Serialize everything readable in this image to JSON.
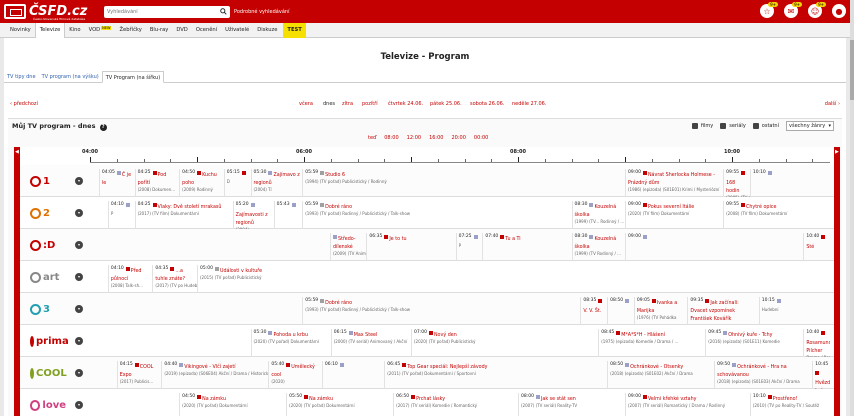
{
  "header": {
    "logo_text": "ČSFD.cz",
    "logo_sub": "Česko-Slovenská filmová databáze",
    "search_placeholder": "Vyhledávání",
    "advanced_search": "Podrobné vyhledávání",
    "icons": [
      {
        "name": "bell-icon",
        "glyph": "☆",
        "badge": "9+"
      },
      {
        "name": "messages-icon",
        "glyph": "✉",
        "badge": "9+"
      },
      {
        "name": "friends-icon",
        "glyph": "☺",
        "badge": "9+"
      },
      {
        "name": "user-avatar-icon",
        "glyph": "●",
        "badge": ""
      }
    ],
    "accent_color": "#c40000"
  },
  "menu": {
    "items": [
      "Novinky",
      "Televize",
      "Kino",
      "VOD",
      "Žebříčky",
      "Blu-ray",
      "DVD",
      "Ocenění",
      "Uživatelé",
      "Diskuze"
    ],
    "active": "Televize",
    "vod_badge": "NEW",
    "test_label": "TEST"
  },
  "page": {
    "title": "Televize - Program",
    "subtabs": [
      "TV tipy dne",
      "TV program (na výšku)",
      "TV Program (na šířku)"
    ],
    "active_subtab": "TV Program (na šířku)",
    "prev_label": "‹ předchozí",
    "next_label": "další ›",
    "days": [
      "včera",
      "dnes",
      "zítra",
      "pozítří",
      "čtvrtek 24.06.",
      "pátek 25.06.",
      "sobota 26.06.",
      "neděle 27.06."
    ],
    "current_day": "dnes"
  },
  "section": {
    "title": "Můj TV program - dnes",
    "help": "?",
    "filters": [
      {
        "label": "filmy",
        "checked": true
      },
      {
        "label": "seriály",
        "checked": true
      },
      {
        "label": "ostatní",
        "checked": true
      }
    ],
    "genre_select": "všechny žánry",
    "time_links": [
      "teď",
      "08:00",
      "12:00",
      "16:00",
      "20:00",
      "00:00"
    ],
    "axis_labels": [
      "04:00",
      "06:00",
      "08:00",
      "10:00"
    ]
  },
  "channels": [
    {
      "name": "ČT1",
      "logo": "1",
      "color": "#c40000",
      "programs": [
        {
          "time": "04:05",
          "title": "Č je le",
          "meta": "",
          "cat": "serial"
        },
        {
          "time": "04:25",
          "title": "Pod pořítí",
          "meta": "(2008) Dokumen...",
          "cat": "film"
        },
        {
          "time": "04:50",
          "title": "Kuchu poho",
          "meta": "(2009) Rodinný",
          "cat": "film"
        },
        {
          "time": "05:15",
          "title": "",
          "meta": "D",
          "cat": "film"
        },
        {
          "time": "05:30",
          "title": "Zajímavo z regionů",
          "meta": "(2004) Tí",
          "cat": "serial"
        },
        {
          "time": "05:59",
          "title": "Studio 6",
          "meta": "(1994) (TV pořad) Publicistický / Rodinný",
          "cat": "ostatni"
        },
        {
          "time": "09:00",
          "title": "Návrat Sherlocka Holmese - Prázdný dům",
          "meta": "(1986) (epizoda) (S01E01) Krimi / Mysteriózní",
          "cat": "film"
        },
        {
          "time": "09:55",
          "title": "168 hodin",
          "meta": "(2005) (TV po Publicistický",
          "cat": "film"
        },
        {
          "time": "10:10",
          "title": "",
          "meta": "",
          "cat": "serial"
        }
      ]
    },
    {
      "name": "ČT2",
      "logo": "2",
      "color": "#e07000",
      "programs": [
        {
          "time": "04:10",
          "title": "",
          "meta": "P",
          "cat": "serial"
        },
        {
          "time": "04:25",
          "title": "Vlaky: Dvě století mrakasů",
          "meta": "(2017) (TV film) Dokumentární",
          "cat": "film"
        },
        {
          "time": "05:20",
          "title": "Zajímavosti z regionů",
          "meta": "(2004)",
          "cat": "serial"
        },
        {
          "time": "05:43",
          "title": "",
          "meta": "",
          "cat": "serial"
        },
        {
          "time": "05:59",
          "title": "Dobré ráno",
          "meta": "(1993) (TV pořad) Rodinný / Publicistický / Talk-show",
          "cat": "ostatni"
        },
        {
          "time": "08:30",
          "title": "Kouzelná školka",
          "meta": "(1999) (TV... Rodinný / ...",
          "cat": "serial"
        },
        {
          "time": "09:00",
          "title": "Pokus severní Itálie",
          "meta": "(2020) (TV film) Dokumentární",
          "cat": "film"
        },
        {
          "time": "09:55",
          "title": "Chytré opice",
          "meta": "(2008) (TV film) Dokumentární",
          "cat": "film"
        }
      ]
    },
    {
      "name": "ČT :D",
      "logo": ":D",
      "color": "#c40000",
      "programs": [
        {
          "time": "",
          "title": "Středo-dílenské",
          "meta": "(2009) (TV Animovaný",
          "cat": "serial"
        },
        {
          "time": "06:35",
          "title": "Je to tu",
          "meta": "",
          "cat": "film"
        },
        {
          "time": "07:25",
          "title": "",
          "meta": "P",
          "cat": "serial"
        },
        {
          "time": "07:40",
          "title": "Tu a Ti",
          "meta": "",
          "cat": "film"
        },
        {
          "time": "08:30",
          "title": "Kouzelná školka",
          "meta": "(1999) (TV Rodinný / ...",
          "cat": "serial"
        },
        {
          "time": "09:00",
          "title": "",
          "meta": "",
          "cat": "serial"
        },
        {
          "time": "10:40",
          "title": "Sté",
          "meta": "",
          "cat": "film"
        }
      ]
    },
    {
      "name": "ČT art",
      "logo": "art",
      "color": "#888888",
      "programs": [
        {
          "time": "04:10",
          "title": "Před půlnocí",
          "meta": "(2008) Talk-sh...",
          "cat": "film"
        },
        {
          "time": "04:35",
          "title": "...a tuhle znáte?",
          "meta": "(2017) (TV po Hudební",
          "cat": "film"
        },
        {
          "time": "05:00",
          "title": "Události v kultuře",
          "meta": "(2015) (TV pořad) Publicistický",
          "cat": "ostatni"
        }
      ]
    },
    {
      "name": "ČT3",
      "logo": "3",
      "color": "#20a0b0",
      "programs": [
        {
          "time": "05:59",
          "title": "Dobré ráno",
          "meta": "(1993) (TV pořad) Rodinný / Publicistický / Talk-show",
          "cat": "ostatni"
        },
        {
          "time": "08:35",
          "title": "V. V. Št.",
          "meta": "",
          "cat": "film"
        },
        {
          "time": "08:50",
          "title": "",
          "meta": "",
          "cat": "serial"
        },
        {
          "time": "09:05",
          "title": "Ivanka a Marijka",
          "meta": "(1976) (TV Pohádka",
          "cat": "film"
        },
        {
          "time": "09:35",
          "title": "Jak začínali: Dvacet vzpomínek František Kovářík",
          "meta": "",
          "cat": "film"
        },
        {
          "time": "10:15",
          "title": "",
          "meta": "Hudební",
          "cat": "serial"
        }
      ]
    },
    {
      "name": "Prima",
      "logo": "prima",
      "color": "#c40000",
      "programs": [
        {
          "time": "05:30",
          "title": "Pohoda u krbu",
          "meta": "(2020) (TV pořad) Dokumentární",
          "cat": "serial"
        },
        {
          "time": "06:15",
          "title": "Max Steel",
          "meta": "(2000) (TV seriál) Animovaný / Akční",
          "cat": "serial"
        },
        {
          "time": "07:00",
          "title": "Nový den",
          "meta": "(2020) (TV pořad) Publicistický",
          "cat": "film"
        },
        {
          "time": "08:45",
          "title": "M*A*S*H - Hlášení",
          "meta": "(1975) (epizoda) Komedie / Drama / ...",
          "cat": "film"
        },
        {
          "time": "09:45",
          "title": "Ohnivý kuře - Tchy",
          "meta": "(2016) (epizoda) (S01E11) Komedie",
          "cat": "serial"
        },
        {
          "time": "10:40",
          "title": "Rosamunde Pilcher",
          "meta": "Drama / Romantický",
          "cat": "film"
        }
      ]
    },
    {
      "name": "COOL",
      "logo": "COOL",
      "color": "#80a020",
      "programs": [
        {
          "time": "04:15",
          "title": "COOL Expo",
          "meta": "(2017) Publicis...",
          "cat": "film"
        },
        {
          "time": "04:40",
          "title": "Vikingové - Vlčí zajetí",
          "meta": "(2019) (epizoda) (S06E04) Akční / Drama / Historický",
          "cat": "serial"
        },
        {
          "time": "05:40",
          "title": "Umělecký cool",
          "meta": "(2020)",
          "cat": "film"
        },
        {
          "time": "06:10",
          "title": "",
          "meta": "",
          "cat": "serial"
        },
        {
          "time": "06:45",
          "title": "Top Gear speciál: Nejlepší závody",
          "meta": "(2011) (TV pořad) Dokumentární / Sportovní",
          "cat": "film"
        },
        {
          "time": "08:50",
          "title": "Ochránkové - Otsenky",
          "meta": "(2018) (epizoda) (S01E02) Akční / Drama",
          "cat": "serial"
        },
        {
          "time": "09:50",
          "title": "Ochránkové - Hra na schovávanou",
          "meta": "(2018) (epizoda) (S01E03) Akční / Drama",
          "cat": "serial"
        },
        {
          "time": "10:45",
          "title": "Hvězdná brána - Prom",
          "meta": "(2003) (epizoda) Akční / Dobrodružný",
          "cat": "film"
        }
      ]
    },
    {
      "name": "love",
      "logo": "love",
      "color": "#d04080",
      "programs": [
        {
          "time": "04:50",
          "title": "Na zámku",
          "meta": "(2020) (TV pořad) Dokumentární",
          "cat": "film"
        },
        {
          "time": "05:50",
          "title": "Na zámku",
          "meta": "(2020) (TV pořad) Dokumentární",
          "cat": "film"
        },
        {
          "time": "06:50",
          "title": "Prchat lásky",
          "meta": "(2017) (TV seriál) Komedie / Romantický",
          "cat": "film"
        },
        {
          "time": "08:00",
          "title": "Jak se stát sen",
          "meta": "(2007) (TV seriál) Reality-TV",
          "cat": "serial"
        },
        {
          "time": "09:00",
          "title": "Velmi křehké vztahy",
          "meta": "(2007) (TV seriál) Romantický / Drama / Rodinný",
          "cat": "film"
        },
        {
          "time": "10:10",
          "title": "Prostřeno!",
          "meta": "(2010) (TV po Reality-TV / Soutěž",
          "cat": "film"
        }
      ]
    }
  ]
}
